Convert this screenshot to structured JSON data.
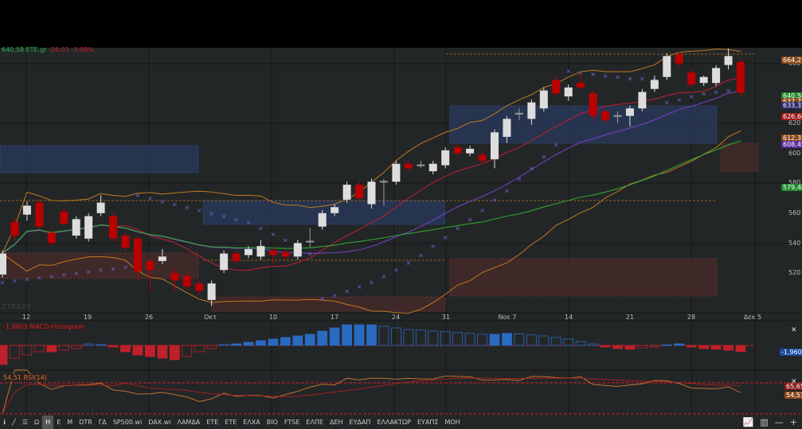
{
  "header": {
    "price": "640,58",
    "symbol": "ΕΤΕ.gr",
    "change": "-26,01",
    "change_pct": "-3,90%"
  },
  "watermark": "ZTRADE",
  "price_axis": {
    "ticks": [
      "660",
      "620",
      "600",
      "580",
      "560",
      "540",
      "520"
    ],
    "labels": [
      {
        "text": "664,2",
        "color": "#8a4a1a"
      },
      {
        "text": "640,58",
        "color": "#1f8a2a"
      },
      {
        "text": "637,73",
        "color": "#8a4a1a"
      },
      {
        "text": "633,33",
        "color": "#2a2a6a"
      },
      {
        "text": "626,66",
        "color": "#a01a1a"
      },
      {
        "text": "612,3",
        "color": "#8a4a1a"
      },
      {
        "text": "608,45",
        "color": "#5a2aa0"
      },
      {
        "text": "579,48",
        "color": "#1f8a2a"
      }
    ]
  },
  "x_axis": [
    "12",
    "19",
    "26",
    "Οκτ",
    "10",
    "17",
    "24",
    "31",
    "Νοε 7",
    "14",
    "21",
    "28",
    "Δεκ 5"
  ],
  "macd": {
    "label": "-1,9603 MACD-Histogram",
    "value": "-1,9603"
  },
  "rsi": {
    "label": "54,51 RSI(14)",
    "upper": "65,65",
    "value": "54,51"
  },
  "toolbar": {
    "items": [
      "Ω",
      "Η",
      "Ε",
      "Μ",
      "DTR",
      "ΓΔ",
      "SP500.wi",
      "DAX.wi",
      "ΛΑΜΔΑ",
      "ΕΤΕ",
      "ΕΤΕ",
      "ΕΛΧΑ",
      "ΒΙΟ",
      "FTSE",
      "ΕΛΠΕ",
      "ΔΕΗ",
      "ΕΥΔΑΠ",
      "ΕΛΛΑΚΤΩΡ",
      "ΕΥΑΠΣ",
      "ΜΟΗ"
    ],
    "active": "Η"
  },
  "chart_data": {
    "type": "candlestick",
    "ylim": [
      500,
      670
    ],
    "candles": [
      [
        519,
        535,
        517,
        533
      ],
      [
        554,
        557,
        542,
        545
      ],
      [
        559,
        568,
        555,
        565
      ],
      [
        567,
        570,
        549,
        551
      ],
      [
        547,
        549,
        538,
        540
      ],
      [
        561,
        563,
        551,
        553
      ],
      [
        545,
        558,
        543,
        556
      ],
      [
        543,
        560,
        541,
        558
      ],
      [
        560,
        572,
        558,
        567
      ],
      [
        558,
        560,
        541,
        543
      ],
      [
        545,
        547,
        535,
        537
      ],
      [
        543,
        545,
        515,
        521
      ],
      [
        528,
        530,
        507,
        522
      ],
      [
        528,
        536,
        526,
        531
      ],
      [
        520,
        523,
        507,
        515
      ],
      [
        518,
        520,
        509,
        511
      ],
      [
        513,
        515,
        506,
        508
      ],
      [
        502,
        515,
        498,
        513
      ],
      [
        522,
        535,
        520,
        533
      ],
      [
        533,
        535,
        526,
        528
      ],
      [
        532,
        538,
        530,
        536
      ],
      [
        531,
        542,
        529,
        538
      ],
      [
        535,
        537,
        526,
        532
      ],
      [
        534,
        536,
        528,
        531
      ],
      [
        531,
        542,
        529,
        540
      ],
      [
        541,
        550,
        537,
        541.5
      ],
      [
        551,
        562,
        549,
        560
      ],
      [
        560,
        566,
        558,
        564
      ],
      [
        569,
        581,
        567,
        579
      ],
      [
        579,
        581,
        568,
        570
      ],
      [
        566,
        583,
        563,
        581
      ],
      [
        581,
        583,
        565,
        581.5
      ],
      [
        581,
        595,
        579,
        593
      ],
      [
        593,
        595,
        588,
        590
      ],
      [
        592,
        595,
        590,
        592.5
      ],
      [
        588,
        595,
        586,
        593
      ],
      [
        592,
        604,
        590,
        602
      ],
      [
        604,
        607,
        598,
        600
      ],
      [
        600,
        605,
        598,
        603
      ],
      [
        599,
        601,
        593,
        595
      ],
      [
        596,
        616,
        590,
        614
      ],
      [
        611,
        625,
        607,
        623
      ],
      [
        626,
        630,
        622,
        627
      ],
      [
        623,
        636,
        619,
        634
      ],
      [
        630,
        644,
        628,
        642
      ],
      [
        649,
        652,
        638,
        640
      ],
      [
        638,
        646,
        635,
        644
      ],
      [
        647,
        654,
        643,
        644
      ],
      [
        640,
        642,
        622,
        625
      ],
      [
        628,
        630,
        620,
        622
      ],
      [
        625,
        628,
        620,
        625.5
      ],
      [
        625,
        632,
        618,
        630
      ],
      [
        630,
        643,
        628,
        641
      ],
      [
        643,
        652,
        641,
        649
      ],
      [
        651,
        667,
        649,
        665
      ],
      [
        666,
        668,
        657,
        660
      ],
      [
        654,
        656,
        644,
        646
      ],
      [
        647,
        652,
        645,
        651
      ],
      [
        647,
        659,
        645,
        657
      ],
      [
        659,
        670,
        656,
        665
      ],
      [
        661,
        664,
        638,
        640.58
      ]
    ],
    "sar": [
      514,
      515,
      516,
      517,
      518,
      519,
      520,
      521,
      522,
      523,
      524,
      572,
      570,
      568,
      566,
      564,
      562,
      560,
      558,
      556,
      554,
      550,
      546,
      542,
      538,
      533,
      503,
      505,
      508,
      511,
      514,
      518,
      522,
      527,
      532,
      538,
      544,
      550,
      556,
      562,
      569,
      575,
      583,
      590,
      598,
      606,
      655,
      654,
      653,
      652,
      651,
      650,
      650,
      649,
      634,
      636,
      638,
      640,
      641,
      642,
      643
    ],
    "macd_hist": [
      -6,
      -4,
      -3,
      -2,
      -2,
      -1.5,
      -1,
      0.5,
      0.3,
      -0.5,
      -2,
      -3,
      -3.5,
      -4,
      -4.5,
      -3.5,
      -2,
      -1,
      0.3,
      0.5,
      1,
      1.5,
      2,
      2.5,
      3,
      3.5,
      4.5,
      5.5,
      6.5,
      6.5,
      6.5,
      6,
      5.5,
      5,
      4.8,
      4.5,
      4.3,
      4,
      3.8,
      3.5,
      3.5,
      3.8,
      3.6,
      3.3,
      3,
      2.5,
      2,
      1.2,
      0.5,
      -0.5,
      -1,
      -1.2,
      -0.8,
      -0.5,
      0.2,
      0.5,
      -0.5,
      -1,
      -1.2,
      -1.5,
      -1.96
    ]
  }
}
